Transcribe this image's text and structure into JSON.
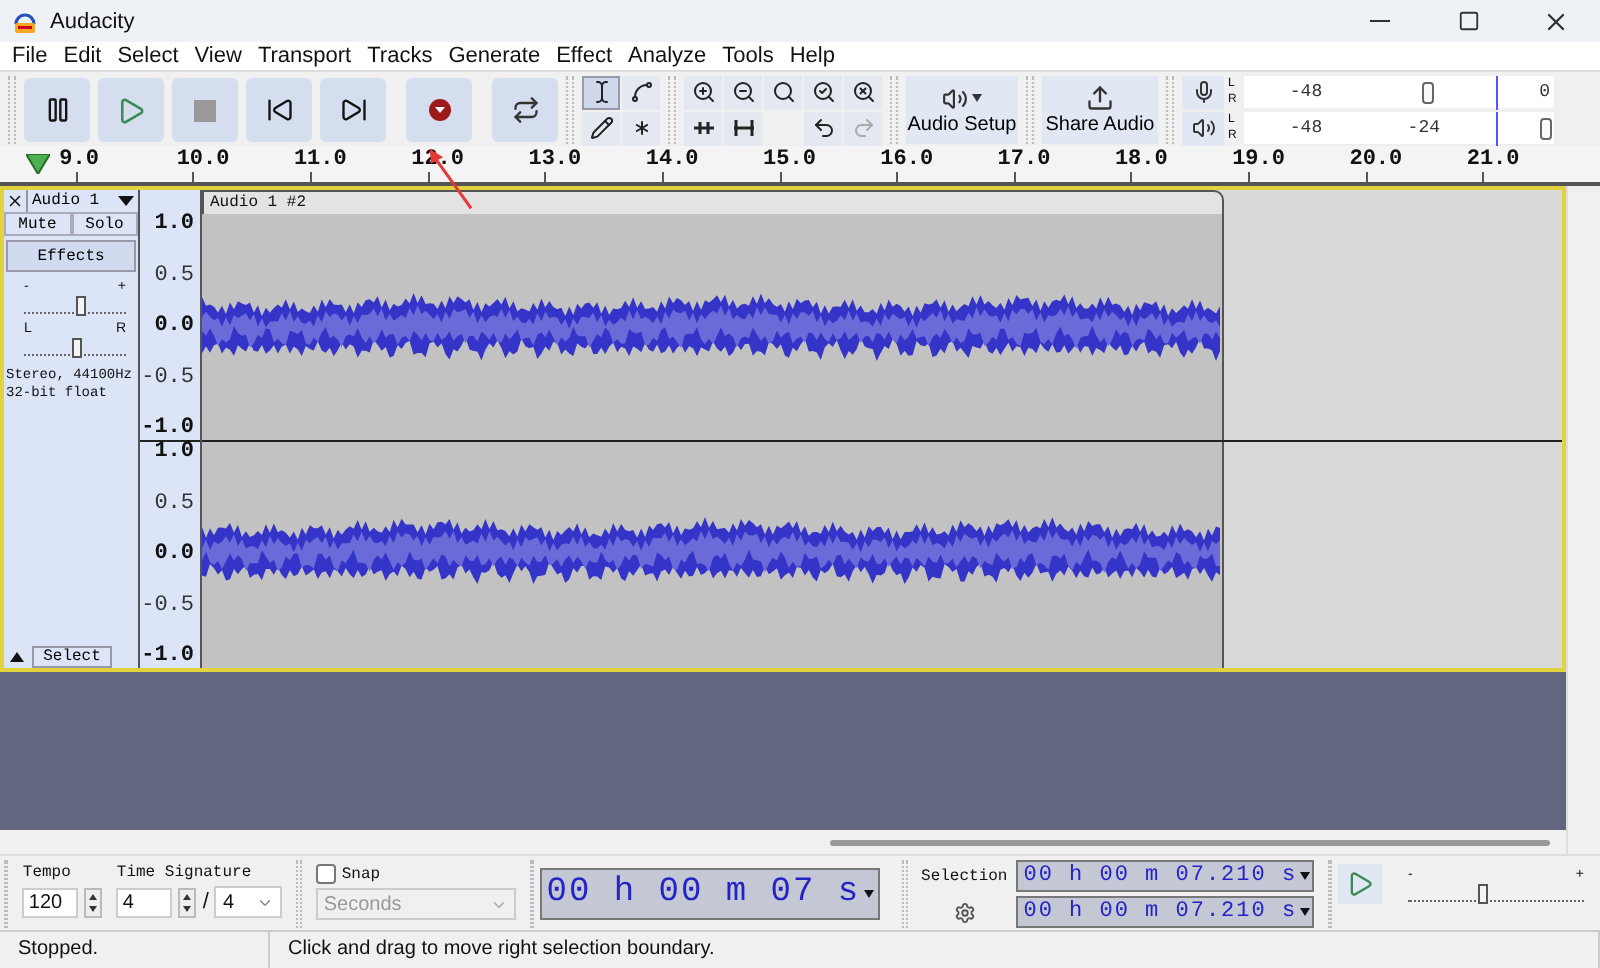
{
  "window": {
    "title": "Audacity"
  },
  "menu": [
    "File",
    "Edit",
    "Select",
    "View",
    "Transport",
    "Tracks",
    "Generate",
    "Effect",
    "Analyze",
    "Tools",
    "Help"
  ],
  "toolbar": {
    "audio_setup": "Audio Setup",
    "share_audio": "Share Audio"
  },
  "meters": [
    {
      "kind": "recording",
      "channels": [
        "L",
        "R"
      ],
      "ticks": [
        "-48",
        "0"
      ],
      "level": 0.62
    },
    {
      "kind": "playback",
      "channels": [
        "L",
        "R"
      ],
      "ticks": [
        "-48",
        "-24"
      ],
      "level": 1.0
    }
  ],
  "ruler": {
    "labels": [
      "9.0",
      "10.0",
      "11.0",
      "12.0",
      "13.0",
      "14.0",
      "15.0",
      "16.0",
      "17.0",
      "18.0",
      "19.0",
      "20.0",
      "21.0"
    ]
  },
  "track": {
    "name": "Audio 1",
    "buttons": [
      "Mute",
      "Solo"
    ],
    "effects": "Effects",
    "gain": {
      "min": "-",
      "max": "+",
      "level": 0.55
    },
    "pan": {
      "min": "L",
      "max": "R",
      "level": 0.5
    },
    "format": [
      "Stereo, 44100Hz",
      "32-bit float"
    ],
    "select": "Select",
    "clip": "Audio 1 #2",
    "channels": [
      {
        "scale": [
          "1.0",
          "0.5",
          "0.0",
          "-0.5",
          "-1.0"
        ]
      },
      {
        "scale": [
          "1.0",
          "0.5",
          "0.0",
          "-0.5",
          "-1.0"
        ]
      }
    ]
  },
  "bottom": {
    "tempo": {
      "label": "Tempo",
      "value": "120"
    },
    "time_signature": {
      "label": "Time Signature",
      "numerator": "4",
      "separator": "/",
      "denominator": "4"
    },
    "snap": {
      "label": "Snap",
      "checked": false,
      "unit": "Seconds",
      "disabled": true
    },
    "time": "00 h 00 m 07 s",
    "selection": {
      "label": "Selection",
      "start": "00 h 00 m 07.210 s",
      "end": "00 h 00 m 07.210 s"
    },
    "play_speed": {
      "min": "-",
      "max": "+",
      "level": 0.42
    }
  },
  "status_bar": [
    "Stopped.",
    "Click and drag to move right selection boundary."
  ]
}
